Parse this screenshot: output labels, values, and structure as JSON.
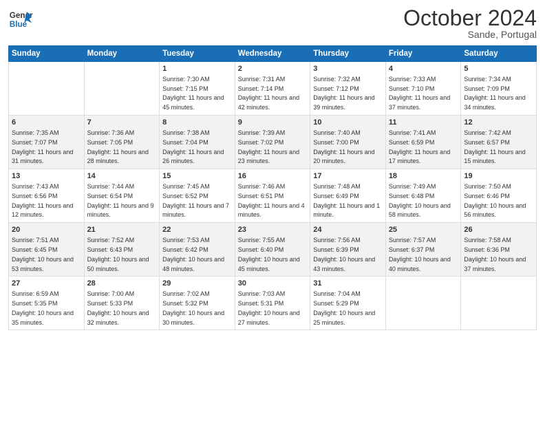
{
  "header": {
    "logo_general": "General",
    "logo_blue": "Blue",
    "month_title": "October 2024",
    "location": "Sande, Portugal"
  },
  "days_of_week": [
    "Sunday",
    "Monday",
    "Tuesday",
    "Wednesday",
    "Thursday",
    "Friday",
    "Saturday"
  ],
  "weeks": [
    [
      {
        "day": "",
        "sunrise": "",
        "sunset": "",
        "daylight": ""
      },
      {
        "day": "",
        "sunrise": "",
        "sunset": "",
        "daylight": ""
      },
      {
        "day": "1",
        "sunrise": "Sunrise: 7:30 AM",
        "sunset": "Sunset: 7:15 PM",
        "daylight": "Daylight: 11 hours and 45 minutes."
      },
      {
        "day": "2",
        "sunrise": "Sunrise: 7:31 AM",
        "sunset": "Sunset: 7:14 PM",
        "daylight": "Daylight: 11 hours and 42 minutes."
      },
      {
        "day": "3",
        "sunrise": "Sunrise: 7:32 AM",
        "sunset": "Sunset: 7:12 PM",
        "daylight": "Daylight: 11 hours and 39 minutes."
      },
      {
        "day": "4",
        "sunrise": "Sunrise: 7:33 AM",
        "sunset": "Sunset: 7:10 PM",
        "daylight": "Daylight: 11 hours and 37 minutes."
      },
      {
        "day": "5",
        "sunrise": "Sunrise: 7:34 AM",
        "sunset": "Sunset: 7:09 PM",
        "daylight": "Daylight: 11 hours and 34 minutes."
      }
    ],
    [
      {
        "day": "6",
        "sunrise": "Sunrise: 7:35 AM",
        "sunset": "Sunset: 7:07 PM",
        "daylight": "Daylight: 11 hours and 31 minutes."
      },
      {
        "day": "7",
        "sunrise": "Sunrise: 7:36 AM",
        "sunset": "Sunset: 7:05 PM",
        "daylight": "Daylight: 11 hours and 28 minutes."
      },
      {
        "day": "8",
        "sunrise": "Sunrise: 7:38 AM",
        "sunset": "Sunset: 7:04 PM",
        "daylight": "Daylight: 11 hours and 26 minutes."
      },
      {
        "day": "9",
        "sunrise": "Sunrise: 7:39 AM",
        "sunset": "Sunset: 7:02 PM",
        "daylight": "Daylight: 11 hours and 23 minutes."
      },
      {
        "day": "10",
        "sunrise": "Sunrise: 7:40 AM",
        "sunset": "Sunset: 7:00 PM",
        "daylight": "Daylight: 11 hours and 20 minutes."
      },
      {
        "day": "11",
        "sunrise": "Sunrise: 7:41 AM",
        "sunset": "Sunset: 6:59 PM",
        "daylight": "Daylight: 11 hours and 17 minutes."
      },
      {
        "day": "12",
        "sunrise": "Sunrise: 7:42 AM",
        "sunset": "Sunset: 6:57 PM",
        "daylight": "Daylight: 11 hours and 15 minutes."
      }
    ],
    [
      {
        "day": "13",
        "sunrise": "Sunrise: 7:43 AM",
        "sunset": "Sunset: 6:56 PM",
        "daylight": "Daylight: 11 hours and 12 minutes."
      },
      {
        "day": "14",
        "sunrise": "Sunrise: 7:44 AM",
        "sunset": "Sunset: 6:54 PM",
        "daylight": "Daylight: 11 hours and 9 minutes."
      },
      {
        "day": "15",
        "sunrise": "Sunrise: 7:45 AM",
        "sunset": "Sunset: 6:52 PM",
        "daylight": "Daylight: 11 hours and 7 minutes."
      },
      {
        "day": "16",
        "sunrise": "Sunrise: 7:46 AM",
        "sunset": "Sunset: 6:51 PM",
        "daylight": "Daylight: 11 hours and 4 minutes."
      },
      {
        "day": "17",
        "sunrise": "Sunrise: 7:48 AM",
        "sunset": "Sunset: 6:49 PM",
        "daylight": "Daylight: 11 hours and 1 minute."
      },
      {
        "day": "18",
        "sunrise": "Sunrise: 7:49 AM",
        "sunset": "Sunset: 6:48 PM",
        "daylight": "Daylight: 10 hours and 58 minutes."
      },
      {
        "day": "19",
        "sunrise": "Sunrise: 7:50 AM",
        "sunset": "Sunset: 6:46 PM",
        "daylight": "Daylight: 10 hours and 56 minutes."
      }
    ],
    [
      {
        "day": "20",
        "sunrise": "Sunrise: 7:51 AM",
        "sunset": "Sunset: 6:45 PM",
        "daylight": "Daylight: 10 hours and 53 minutes."
      },
      {
        "day": "21",
        "sunrise": "Sunrise: 7:52 AM",
        "sunset": "Sunset: 6:43 PM",
        "daylight": "Daylight: 10 hours and 50 minutes."
      },
      {
        "day": "22",
        "sunrise": "Sunrise: 7:53 AM",
        "sunset": "Sunset: 6:42 PM",
        "daylight": "Daylight: 10 hours and 48 minutes."
      },
      {
        "day": "23",
        "sunrise": "Sunrise: 7:55 AM",
        "sunset": "Sunset: 6:40 PM",
        "daylight": "Daylight: 10 hours and 45 minutes."
      },
      {
        "day": "24",
        "sunrise": "Sunrise: 7:56 AM",
        "sunset": "Sunset: 6:39 PM",
        "daylight": "Daylight: 10 hours and 43 minutes."
      },
      {
        "day": "25",
        "sunrise": "Sunrise: 7:57 AM",
        "sunset": "Sunset: 6:37 PM",
        "daylight": "Daylight: 10 hours and 40 minutes."
      },
      {
        "day": "26",
        "sunrise": "Sunrise: 7:58 AM",
        "sunset": "Sunset: 6:36 PM",
        "daylight": "Daylight: 10 hours and 37 minutes."
      }
    ],
    [
      {
        "day": "27",
        "sunrise": "Sunrise: 6:59 AM",
        "sunset": "Sunset: 5:35 PM",
        "daylight": "Daylight: 10 hours and 35 minutes."
      },
      {
        "day": "28",
        "sunrise": "Sunrise: 7:00 AM",
        "sunset": "Sunset: 5:33 PM",
        "daylight": "Daylight: 10 hours and 32 minutes."
      },
      {
        "day": "29",
        "sunrise": "Sunrise: 7:02 AM",
        "sunset": "Sunset: 5:32 PM",
        "daylight": "Daylight: 10 hours and 30 minutes."
      },
      {
        "day": "30",
        "sunrise": "Sunrise: 7:03 AM",
        "sunset": "Sunset: 5:31 PM",
        "daylight": "Daylight: 10 hours and 27 minutes."
      },
      {
        "day": "31",
        "sunrise": "Sunrise: 7:04 AM",
        "sunset": "Sunset: 5:29 PM",
        "daylight": "Daylight: 10 hours and 25 minutes."
      },
      {
        "day": "",
        "sunrise": "",
        "sunset": "",
        "daylight": ""
      },
      {
        "day": "",
        "sunrise": "",
        "sunset": "",
        "daylight": ""
      }
    ]
  ]
}
